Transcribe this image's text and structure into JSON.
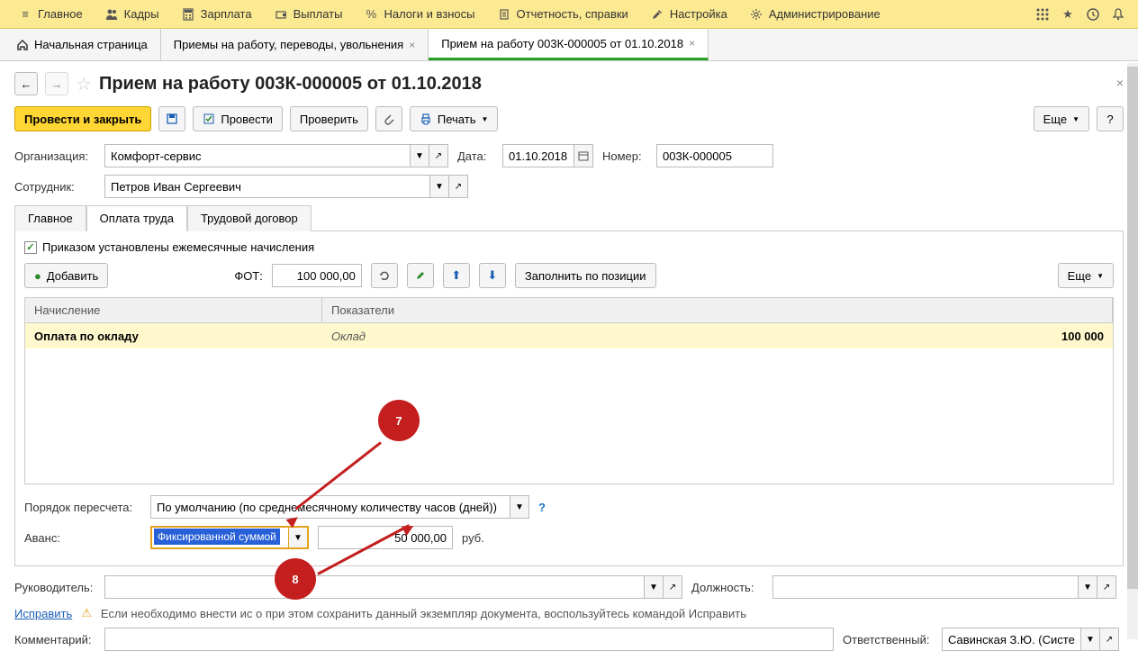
{
  "top_menu": {
    "items": [
      {
        "icon": "menu",
        "label": "Главное"
      },
      {
        "icon": "people",
        "label": "Кадры"
      },
      {
        "icon": "calc",
        "label": "Зарплата"
      },
      {
        "icon": "pay",
        "label": "Выплаты"
      },
      {
        "icon": "percent",
        "label": "Налоги и взносы"
      },
      {
        "icon": "doc",
        "label": "Отчетность, справки"
      },
      {
        "icon": "wrench",
        "label": "Настройка"
      },
      {
        "icon": "gear",
        "label": "Администрирование"
      }
    ]
  },
  "tabs": {
    "home": "Начальная страница",
    "tab1": "Приемы на работу, переводы, увольнения",
    "tab2": "Прием на работу 003К-000005 от 01.10.2018"
  },
  "page_title": "Прием на работу 003К-000005 от 01.10.2018",
  "toolbar": {
    "primary": "Провести и закрыть",
    "conduct": "Провести",
    "check": "Проверить",
    "print": "Печать",
    "more": "Еще"
  },
  "fields": {
    "org_label": "Организация:",
    "org_value": "Комфорт-сервис",
    "date_label": "Дата:",
    "date_value": "01.10.2018",
    "number_label": "Номер:",
    "number_value": "003К-000005",
    "employee_label": "Сотрудник:",
    "employee_value": "Петров Иван Сергеевич"
  },
  "inner_tabs": {
    "main": "Главное",
    "pay": "Оплата труда",
    "contract": "Трудовой договор"
  },
  "checkbox_label": "Приказом установлены ежемесячные начисления",
  "sub_toolbar": {
    "add": "Добавить",
    "fot_label": "ФОТ:",
    "fot_value": "100 000,00",
    "fill": "Заполнить по позиции",
    "more": "Еще"
  },
  "table": {
    "col1": "Начисление",
    "col2": "Показатели",
    "row1_accrual": "Оплата по окладу",
    "row1_indicator": "Оклад",
    "row1_value": "100 000"
  },
  "bottom": {
    "recalc_label": "Порядок пересчета:",
    "recalc_value": "По умолчанию (по среднемесячному количеству часов (дней))",
    "advance_label": "Аванс:",
    "advance_value": "Фиксированной суммой",
    "advance_amount": "50 000,00",
    "advance_unit": "руб.",
    "manager_label": "Руководитель:",
    "position_label": "Должность:",
    "fix_link": "Исправить",
    "fix_note": "Если необходимо внести ис                   о при этом сохранить данный экземпляр документа, воспользуйтесь командой Исправить",
    "comment_label": "Комментарий:",
    "responsible_label": "Ответственный:",
    "responsible_value": "Савинская З.Ю. (Систем"
  },
  "callouts": {
    "c7": "7",
    "c8": "8"
  }
}
